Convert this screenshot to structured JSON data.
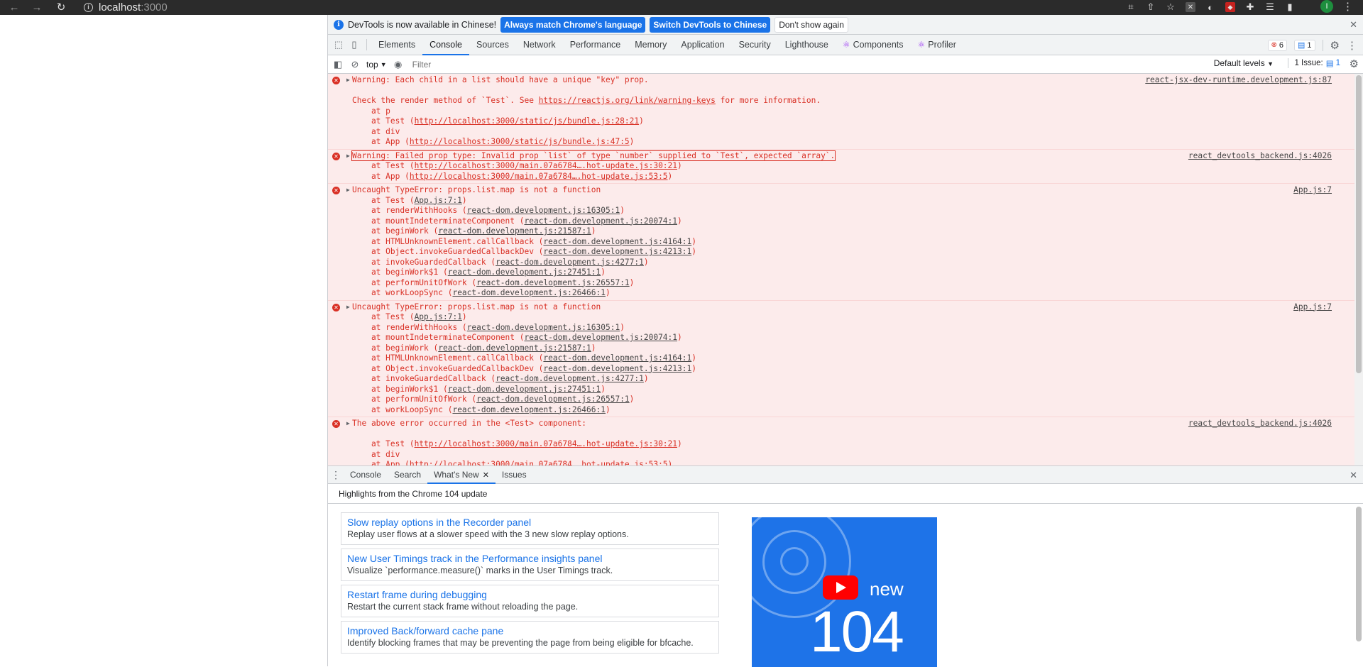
{
  "browser": {
    "url_host": "localhost",
    "url_port": ":3000",
    "avatar_initial": "I"
  },
  "infobar": {
    "message": "DevTools is now available in Chinese!",
    "btn_match": "Always match Chrome's language",
    "btn_switch": "Switch DevTools to Chinese",
    "btn_dismiss": "Don't show again"
  },
  "tabs": [
    "Elements",
    "Console",
    "Sources",
    "Network",
    "Performance",
    "Memory",
    "Application",
    "Security",
    "Lighthouse",
    "Components",
    "Profiler"
  ],
  "counters": {
    "errors": "6",
    "messages": "1"
  },
  "filterbar": {
    "context": "top",
    "filter_placeholder": "Filter",
    "levels": "Default levels",
    "issues_label": "1 Issue:",
    "issues_count": "1"
  },
  "console": {
    "messages": [
      {
        "text": "Warning: Each child in a list should have a unique \"key\" prop.",
        "source": "react-jsx-dev-runtime.development.js:87",
        "lines": [
          {
            "pre": "",
            "link": "",
            "post": ""
          },
          {
            "pre": "Check the render method of `Test`. See ",
            "link": "https://reactjs.org/link/warning-keys",
            "post": " for more information."
          },
          {
            "pre": "    at p",
            "link": "",
            "post": ""
          },
          {
            "pre": "    at Test (",
            "link": "http://localhost:3000/static/js/bundle.js:28:21",
            "post": ")"
          },
          {
            "pre": "    at div",
            "link": "",
            "post": ""
          },
          {
            "pre": "    at App (",
            "link": "http://localhost:3000/static/js/bundle.js:47:5",
            "post": ")"
          }
        ]
      },
      {
        "text": "Warning: Failed prop type: Invalid prop `list` of type `number` supplied to `Test`, expected `array`.",
        "source": "react_devtools_backend.js:4026",
        "lines": [
          {
            "pre": "    at Test (",
            "link": "http://localhost:3000/main.07a6784….hot-update.js:30:21",
            "post": ")"
          },
          {
            "pre": "    at App (",
            "link": "http://localhost:3000/main.07a6784….hot-update.js:53:5",
            "post": ")"
          }
        ]
      },
      {
        "text": "Uncaught TypeError: props.list.map is not a function",
        "source": "App.js:7",
        "lines": [
          {
            "pre": "    at Test (",
            "link": "App.js:7:1",
            "post": ")"
          },
          {
            "pre": "    at renderWithHooks (",
            "link": "react-dom.development.js:16305:1",
            "post": ")"
          },
          {
            "pre": "    at mountIndeterminateComponent (",
            "link": "react-dom.development.js:20074:1",
            "post": ")"
          },
          {
            "pre": "    at beginWork (",
            "link": "react-dom.development.js:21587:1",
            "post": ")"
          },
          {
            "pre": "    at HTMLUnknownElement.callCallback (",
            "link": "react-dom.development.js:4164:1",
            "post": ")"
          },
          {
            "pre": "    at Object.invokeGuardedCallbackDev (",
            "link": "react-dom.development.js:4213:1",
            "post": ")"
          },
          {
            "pre": "    at invokeGuardedCallback (",
            "link": "react-dom.development.js:4277:1",
            "post": ")"
          },
          {
            "pre": "    at beginWork$1 (",
            "link": "react-dom.development.js:27451:1",
            "post": ")"
          },
          {
            "pre": "    at performUnitOfWork (",
            "link": "react-dom.development.js:26557:1",
            "post": ")"
          },
          {
            "pre": "    at workLoopSync (",
            "link": "react-dom.development.js:26466:1",
            "post": ")"
          }
        ]
      },
      {
        "text": "Uncaught TypeError: props.list.map is not a function",
        "source": "App.js:7",
        "lines": [
          {
            "pre": "    at Test (",
            "link": "App.js:7:1",
            "post": ")"
          },
          {
            "pre": "    at renderWithHooks (",
            "link": "react-dom.development.js:16305:1",
            "post": ")"
          },
          {
            "pre": "    at mountIndeterminateComponent (",
            "link": "react-dom.development.js:20074:1",
            "post": ")"
          },
          {
            "pre": "    at beginWork (",
            "link": "react-dom.development.js:21587:1",
            "post": ")"
          },
          {
            "pre": "    at HTMLUnknownElement.callCallback (",
            "link": "react-dom.development.js:4164:1",
            "post": ")"
          },
          {
            "pre": "    at Object.invokeGuardedCallbackDev (",
            "link": "react-dom.development.js:4213:1",
            "post": ")"
          },
          {
            "pre": "    at invokeGuardedCallback (",
            "link": "react-dom.development.js:4277:1",
            "post": ")"
          },
          {
            "pre": "    at beginWork$1 (",
            "link": "react-dom.development.js:27451:1",
            "post": ")"
          },
          {
            "pre": "    at performUnitOfWork (",
            "link": "react-dom.development.js:26557:1",
            "post": ")"
          },
          {
            "pre": "    at workLoopSync (",
            "link": "react-dom.development.js:26466:1",
            "post": ")"
          }
        ]
      },
      {
        "text": "The above error occurred in the <Test> component:",
        "source": "react_devtools_backend.js:4026",
        "lines": [
          {
            "pre": "",
            "link": "",
            "post": ""
          },
          {
            "pre": "    at Test (",
            "link": "http://localhost:3000/main.07a6784….hot-update.js:30:21",
            "post": ")"
          },
          {
            "pre": "    at div",
            "link": "",
            "post": ""
          },
          {
            "pre": "    at App (",
            "link": "http://localhost:3000/main.07a6784….hot-update.js:53:5",
            "post": ")"
          }
        ]
      }
    ]
  },
  "drawer": {
    "tabs": [
      "Console",
      "Search",
      "What's New",
      "Issues"
    ],
    "header": "Highlights from the Chrome 104 update",
    "cards": [
      {
        "title": "Slow replay options in the Recorder panel",
        "desc": "Replay user flows at a slower speed with the 3 new slow replay options."
      },
      {
        "title": "New User Timings track in the Performance insights panel",
        "desc": "Visualize `performance.measure()` marks in the User Timings track."
      },
      {
        "title": "Restart frame during debugging",
        "desc": "Restart the current stack frame without reloading the page."
      },
      {
        "title": "Improved Back/forward cache pane",
        "desc": "Identify blocking frames that may be preventing the page from being eligible for bfcache."
      }
    ],
    "video": {
      "word": "new",
      "number": "104"
    }
  }
}
